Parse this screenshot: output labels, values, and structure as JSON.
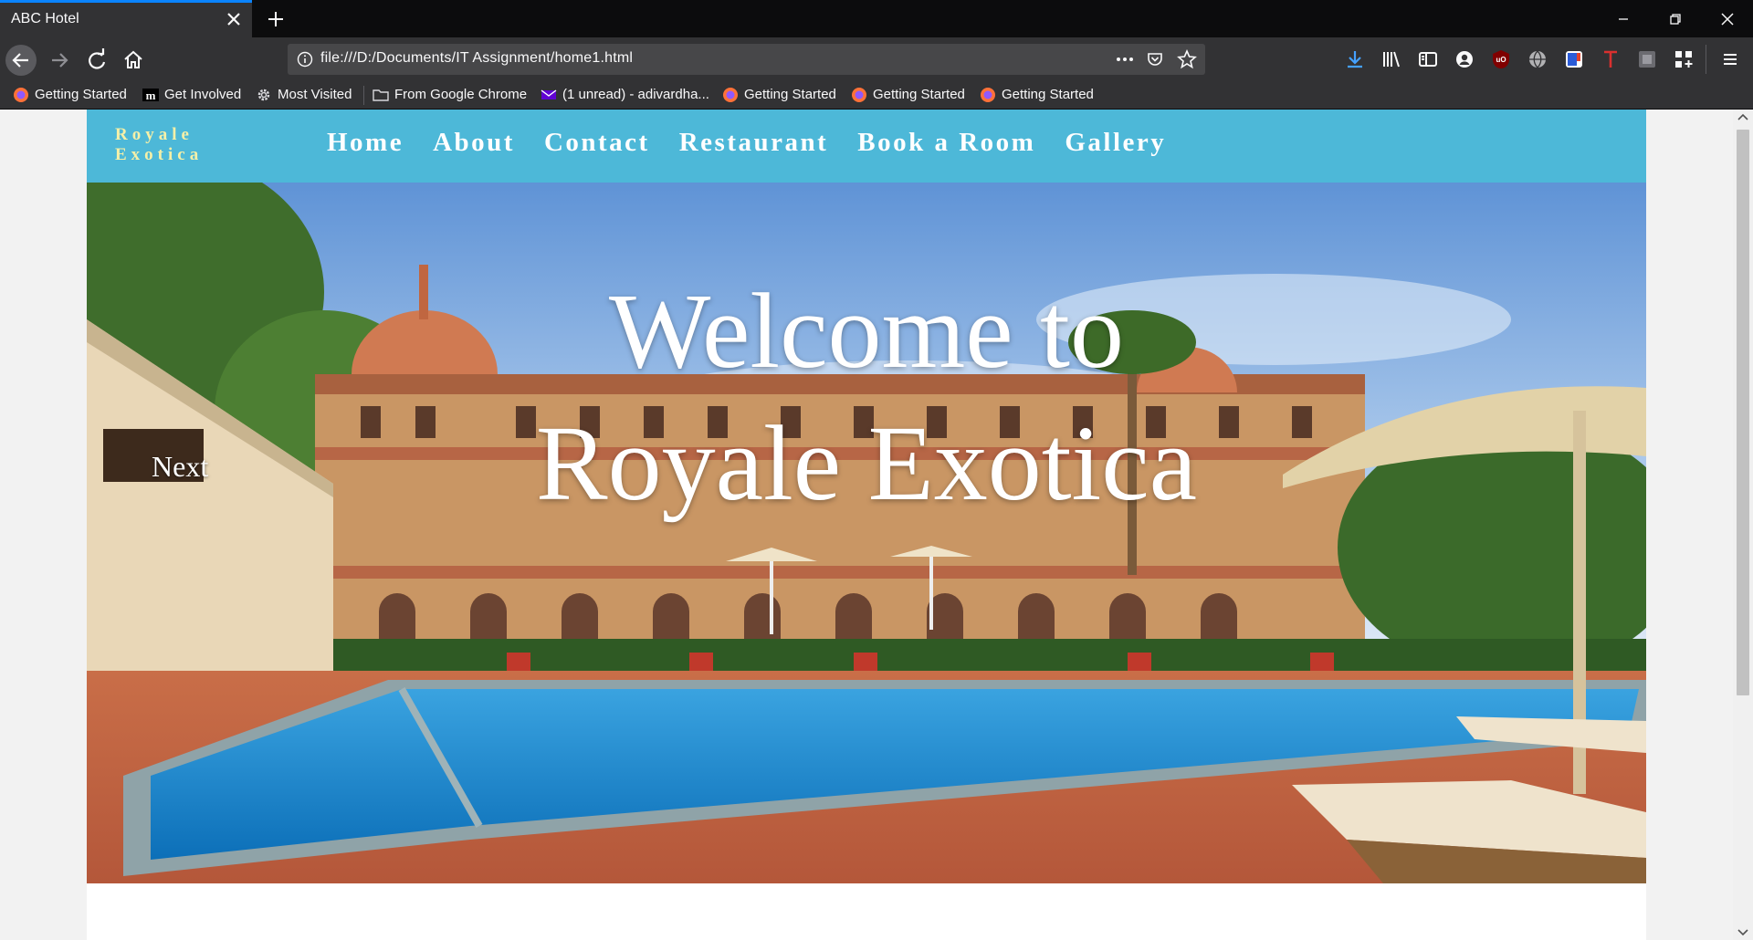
{
  "browser": {
    "tab_title": "ABC Hotel",
    "url": "file:///D:/Documents/IT Assignment/home1.html",
    "bookmarks": [
      {
        "label": "Getting Started",
        "icon": "firefox-icon"
      },
      {
        "label": "Get Involved",
        "icon": "mozilla-icon"
      },
      {
        "label": "Most Visited",
        "icon": "gear-icon"
      },
      {
        "label": "From Google Chrome",
        "icon": "folder-icon"
      },
      {
        "label": "(1 unread) - adivardha...",
        "icon": "yahoo-mail-icon"
      },
      {
        "label": "Getting Started",
        "icon": "firefox-icon"
      },
      {
        "label": "Getting Started",
        "icon": "firefox-icon"
      },
      {
        "label": "Getting Started",
        "icon": "firefox-icon"
      }
    ]
  },
  "site": {
    "logo_line1": "Royale",
    "logo_line2": "Exotica",
    "nav": [
      "Home",
      "About",
      "Contact",
      "Restaurant",
      "Book a Room",
      "Gallery"
    ],
    "hero_line1": "Welcome to",
    "hero_line2": "Royale Exotica",
    "next_label": "Next"
  },
  "colors": {
    "nav_background": "#4db8d8",
    "logo_text": "#f5f0a8",
    "tab_accent": "#0a84ff"
  }
}
